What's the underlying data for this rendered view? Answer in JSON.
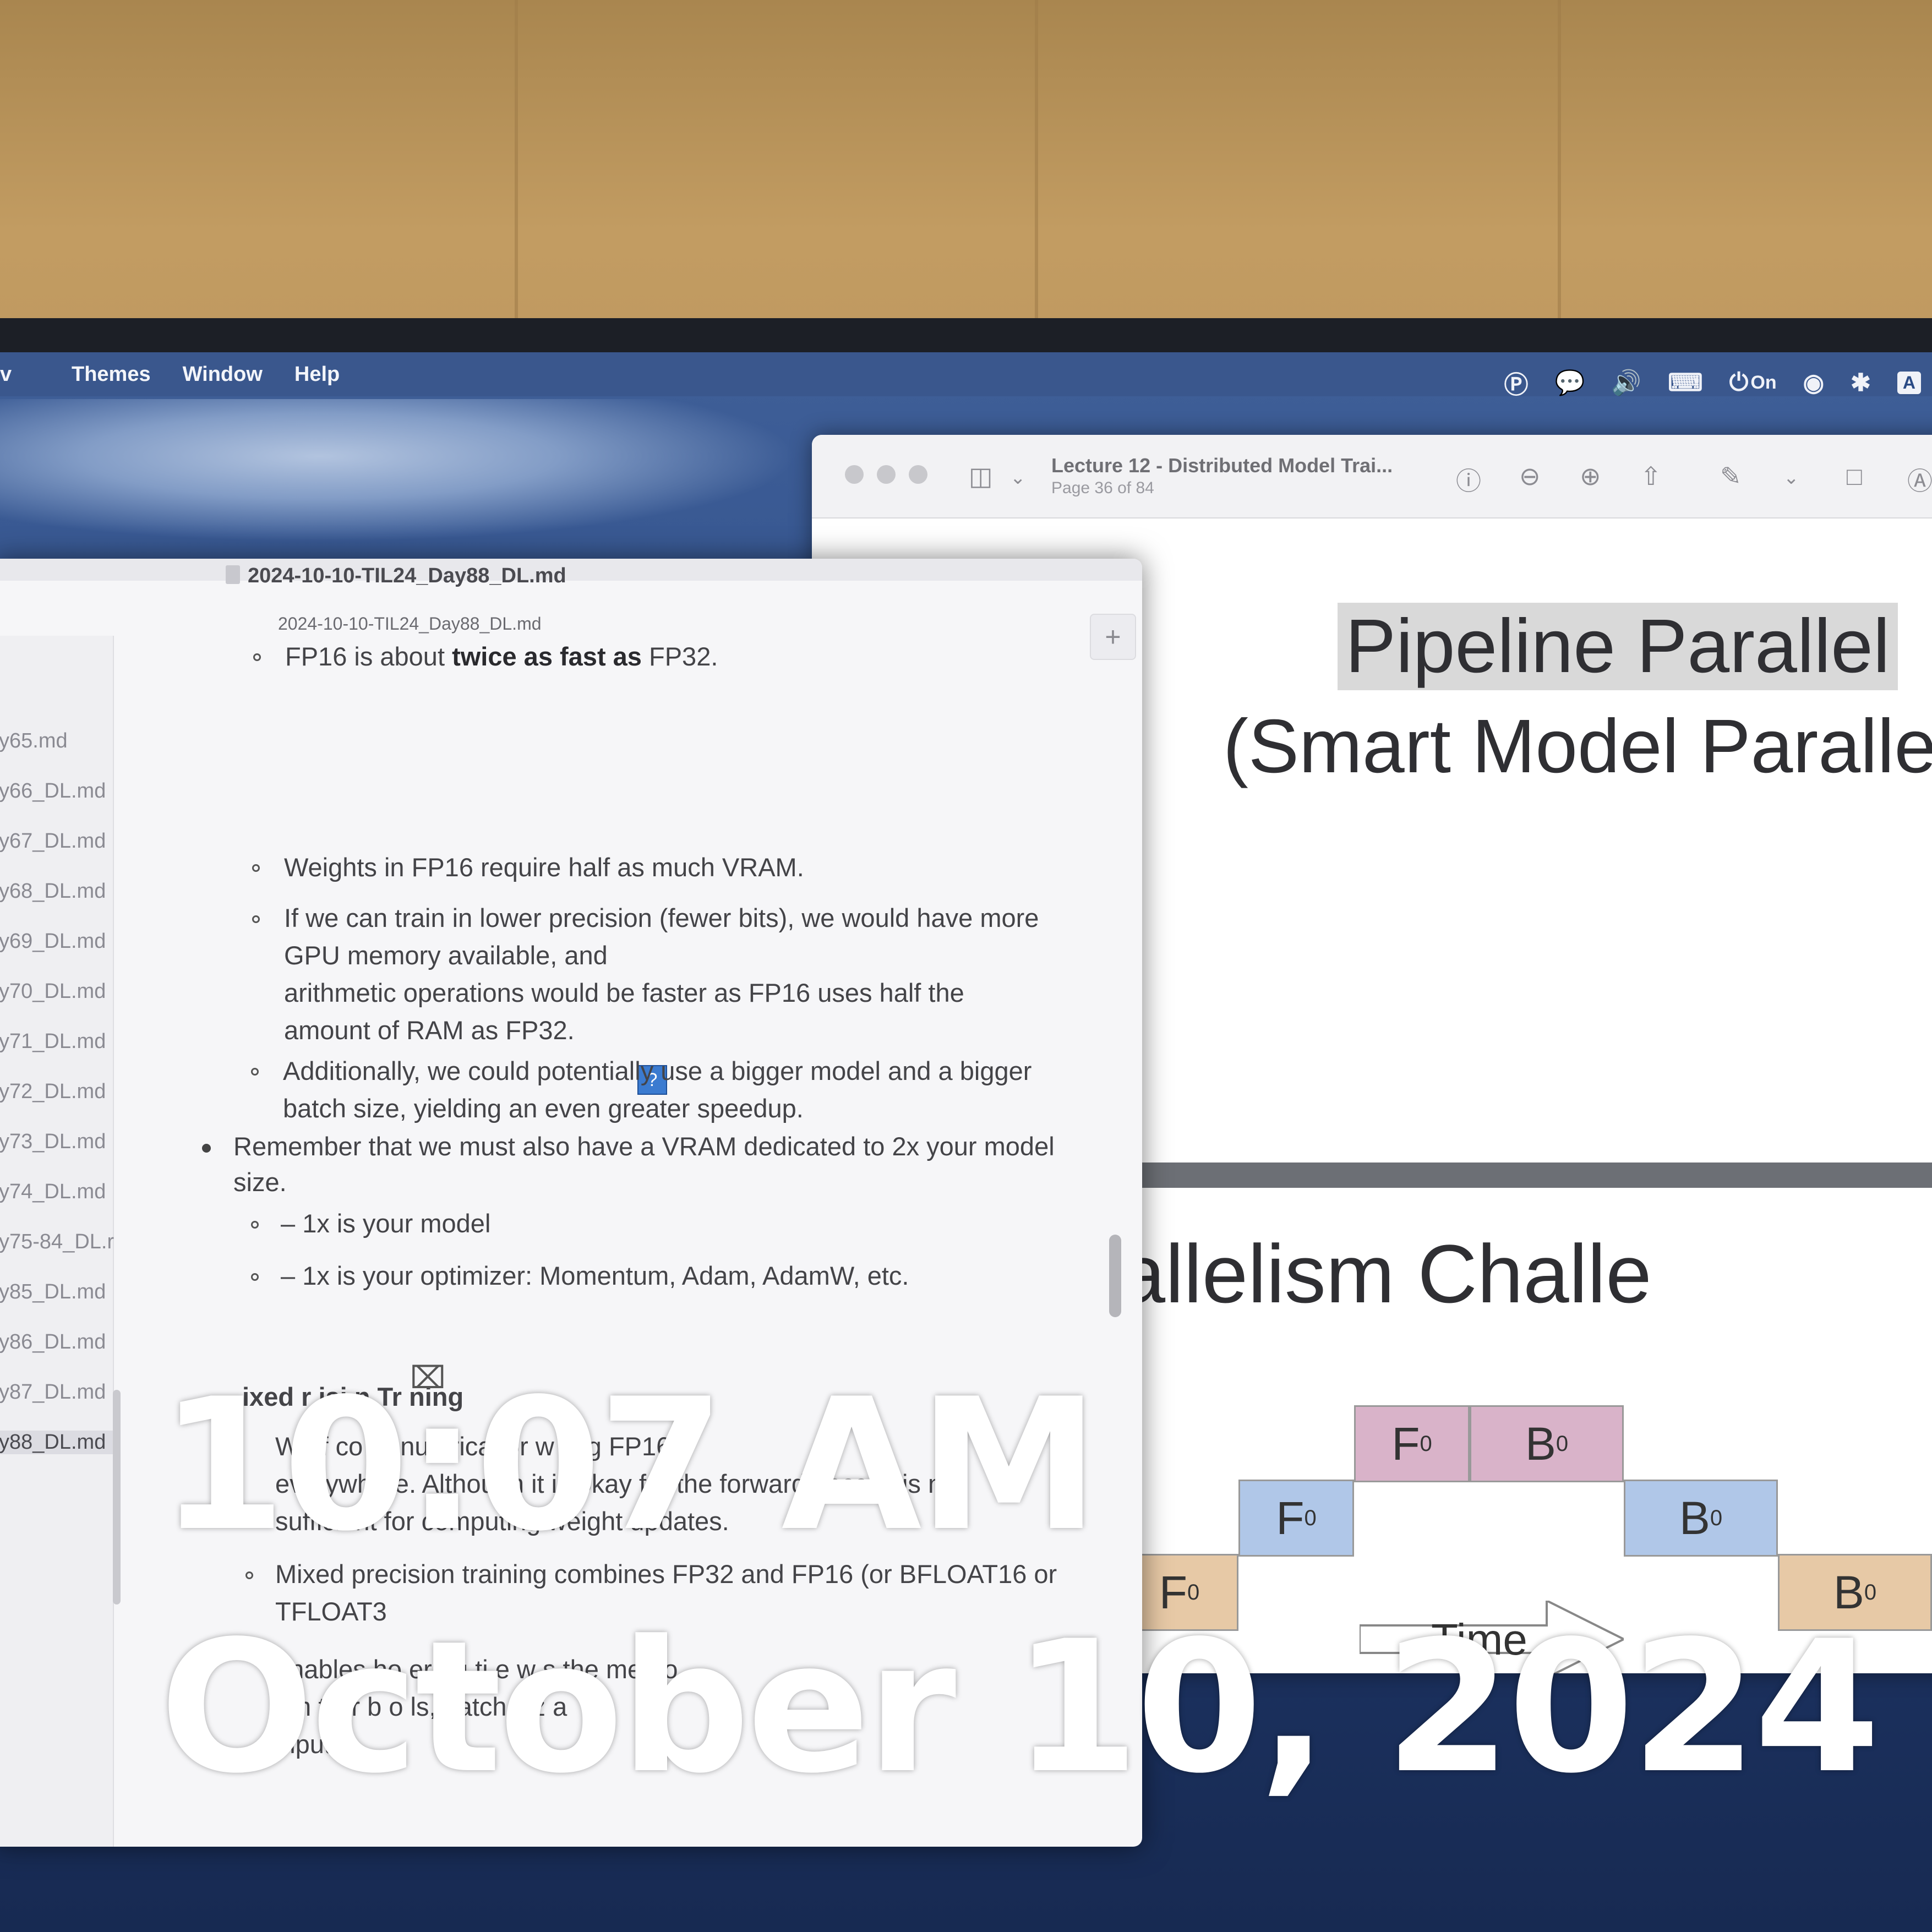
{
  "menubar": {
    "items": [
      "Themes",
      "Window",
      "Help"
    ],
    "status": {
      "battery_label": "On",
      "input_label": "A"
    }
  },
  "preview": {
    "title": "Lecture 12 - Distributed Model Trai...",
    "page": "Page 36 of 84",
    "slide1": {
      "title": "Pipeline Parallel",
      "subtitle": "(Smart Model Paralle"
    },
    "slide2": {
      "title": "odel Parallelism Challe",
      "time_label": "Time"
    },
    "blocks": {
      "forward": "F",
      "backward": "B",
      "index": "0"
    }
  },
  "editor": {
    "tab_title": "2024-10-10-TIL24_Day88_DL.md",
    "doc_heading": "2024-10-10-TIL24_Day88_DL.md",
    "plus_label": "+",
    "image_placeholder": "?",
    "sidebar_files": [
      "y65.md",
      "y66_DL.md",
      "y67_DL.md",
      "y68_DL.md",
      "y69_DL.md",
      "y70_DL.md",
      "y71_DL.md",
      "y72_DL.md",
      "y73_DL.md",
      "y74_DL.md",
      "y75-84_DL.r",
      "y85_DL.md",
      "y86_DL.md",
      "y87_DL.md",
      "y88_DL.md"
    ],
    "lines": {
      "fp16_a": "FP16 is about ",
      "fp16_b": "twice as fast as",
      "fp16_c": " FP32.",
      "weights": "Weights in FP16 require half as much VRAM.",
      "lower1": "If we can train in lower precision (fewer bits), we would have more",
      "lower2": "GPU memory available, and",
      "lower3": "arithmetic operations would be faster as FP16 uses half the",
      "lower4": "amount of RAM as FP32.",
      "add1": "Additionally, we could potentially use a bigger model and a bigger",
      "add2": "batch size, yielding an even greater speedup.",
      "rem1": "Remember that we must also have a VRAM dedicated to 2x your model",
      "rem2": "size.",
      "model": "– 1x is your model",
      "optimizer": "– 1x is your optimizer: Momentum, Adam, AdamW, etc.",
      "mixed_heading": "ixed  r  isi n Tr  ning",
      "often1": "W   of    co   er nu   erical pr      w    si  g FP16",
      "often2": "everywhere. Although it is okay for the forward pass, it is not",
      "often3": "sufficient for computing weight updates.",
      "mixed1": "Mixed precision training combines FP32 and FP16 (or BFLOAT16 or",
      "mixed2": "TFLOAT3",
      "enables1": "enables  ho   er t    g ti   e      w   s the memo",
      "enables2": "   em   ts        ir    b       o  ls, batch siz   a",
      "enables3": "inputs."
    }
  },
  "overlay": {
    "time": "10:07 AM",
    "date": "October 10, 2024"
  }
}
